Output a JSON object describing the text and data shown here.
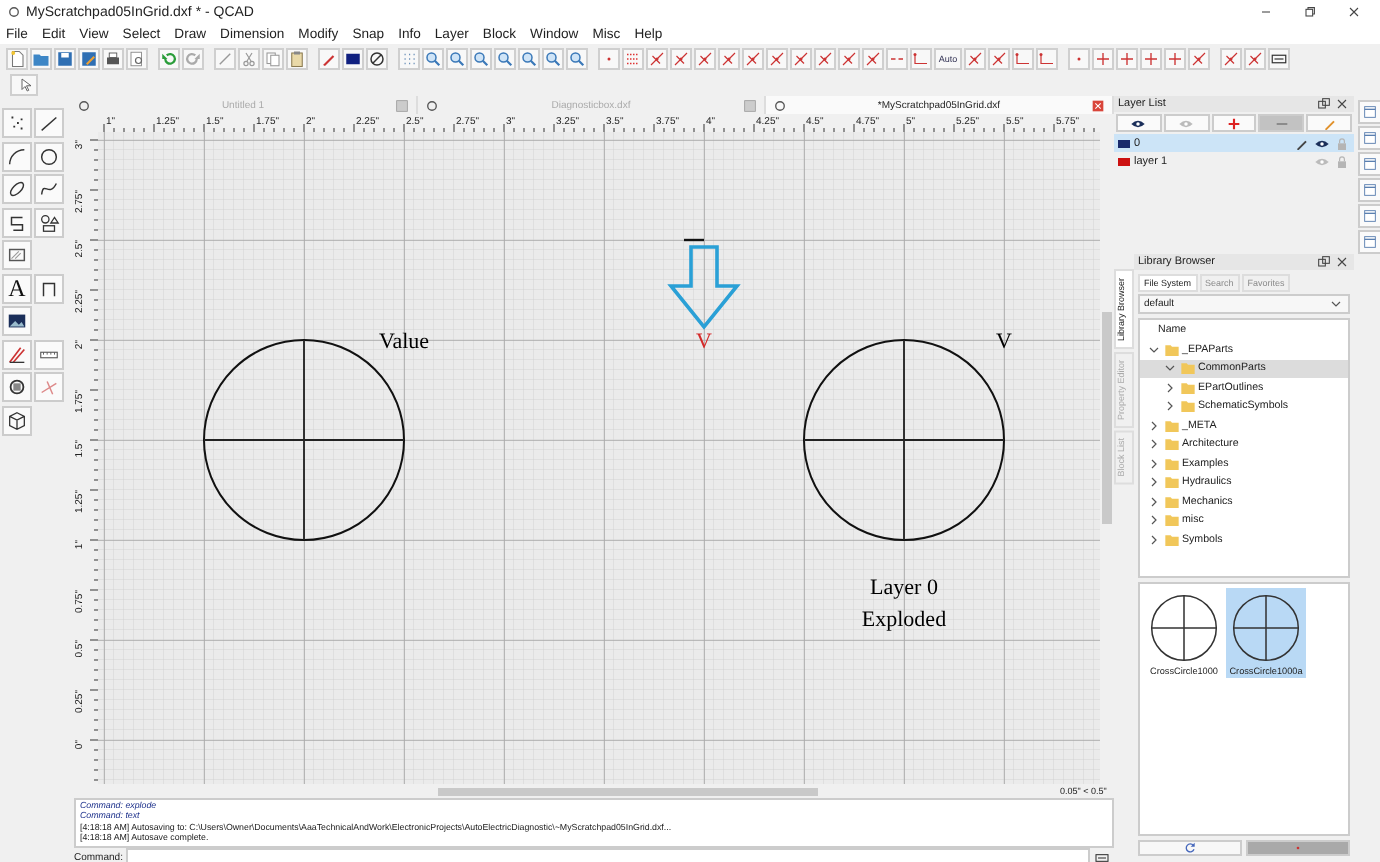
{
  "window": {
    "title": "MyScratchpad05InGrid.dxf * - QCAD"
  },
  "menu": [
    "File",
    "Edit",
    "View",
    "Select",
    "Draw",
    "Dimension",
    "Modify",
    "Snap",
    "Info",
    "Layer",
    "Block",
    "Window",
    "Misc",
    "Help"
  ],
  "toolbar": {
    "auto_label": "Auto"
  },
  "tool_palette": {
    "text_tool_glyph": "A"
  },
  "document_tabs": [
    {
      "label": "Untitled 1",
      "selected": false
    },
    {
      "label": "Diagnosticbox.dxf",
      "selected": false
    },
    {
      "label": "*MyScratchpad05InGrid.dxf",
      "selected": true
    }
  ],
  "ruler_top": [
    "1\"",
    "1.25\"",
    "1.5\"",
    "1.75\"",
    "2\"",
    "2.25\"",
    "2.5\"",
    "2.75\"",
    "3\"",
    "3.25\"",
    "3.5\"",
    "3.75\"",
    "4\"",
    "4.25\"",
    "4.5\"",
    "4.75\"",
    "5\"",
    "5.25\"",
    "5.5\"",
    "5.75\""
  ],
  "ruler_left": [
    "3\"",
    "2.75\"",
    "2.5\"",
    "2.25\"",
    "2\"",
    "1.75\"",
    "1.5\"",
    "1.25\"",
    "1\"",
    "0.75\"",
    "0.5\"",
    "0.25\"",
    "0\""
  ],
  "drawing": {
    "texts": [
      {
        "text": "Value",
        "color": "#000000"
      },
      {
        "text": "V",
        "color": "#d42a2a"
      },
      {
        "text": "V",
        "color": "#000000"
      },
      {
        "text": "Layer 0",
        "color": "#000000"
      },
      {
        "text": "Exploded",
        "color": "#000000"
      }
    ]
  },
  "grid_display": "0.05\" < 0.5\"",
  "command_history": [
    {
      "text": "Command: explode",
      "kind": "command"
    },
    {
      "text": "Command: text",
      "kind": "command"
    },
    {
      "text": "[4:18:18 AM] Autosaving to: C:\\Users\\Owner\\Documents\\AaaTechnicalAndWork\\ElectronicProjects\\AutoElectricDiagnostic\\~MyScratchpad05InGrid.dxf...",
      "kind": "log"
    },
    {
      "text": "[4:18:18 AM] Autosave complete.",
      "kind": "log"
    }
  ],
  "command_line": {
    "label": "Command:"
  },
  "layer_list": {
    "title": "Layer List",
    "layers": [
      {
        "name": "0",
        "color": "#1a2a6c",
        "selected": true,
        "visible": true
      },
      {
        "name": "layer 1",
        "color": "#cc1111",
        "selected": false,
        "visible": false
      }
    ]
  },
  "side_tabs": [
    {
      "label": "Library Browser",
      "selected": true
    },
    {
      "label": "Property Editor",
      "selected": false
    },
    {
      "label": "Block List",
      "selected": false
    }
  ],
  "library_browser": {
    "title": "Library Browser",
    "tabs": [
      {
        "label": "File System",
        "selected": true
      },
      {
        "label": "Search",
        "selected": false
      },
      {
        "label": "Favorites",
        "selected": false
      }
    ],
    "source": "default",
    "column": "Name",
    "tree": [
      {
        "label": "_EPAParts",
        "expanded": true,
        "selected": false,
        "children": [
          {
            "label": "CommonParts",
            "expanded": true,
            "selected": true
          },
          {
            "label": "EPartOutlines",
            "expanded": false,
            "selected": false
          },
          {
            "label": "SchematicSymbols",
            "expanded": false,
            "selected": false
          }
        ]
      },
      {
        "label": "_META",
        "expanded": false,
        "selected": false
      },
      {
        "label": "Architecture",
        "expanded": false,
        "selected": false
      },
      {
        "label": "Examples",
        "expanded": false,
        "selected": false
      },
      {
        "label": "Hydraulics",
        "expanded": false,
        "selected": false
      },
      {
        "label": "Mechanics",
        "expanded": false,
        "selected": false
      },
      {
        "label": "misc",
        "expanded": false,
        "selected": false
      },
      {
        "label": "Symbols",
        "expanded": false,
        "selected": false
      }
    ],
    "items": [
      {
        "label": "CrossCircle1000",
        "selected": false
      },
      {
        "label": "CrossCircle1000a",
        "selected": true
      }
    ]
  }
}
